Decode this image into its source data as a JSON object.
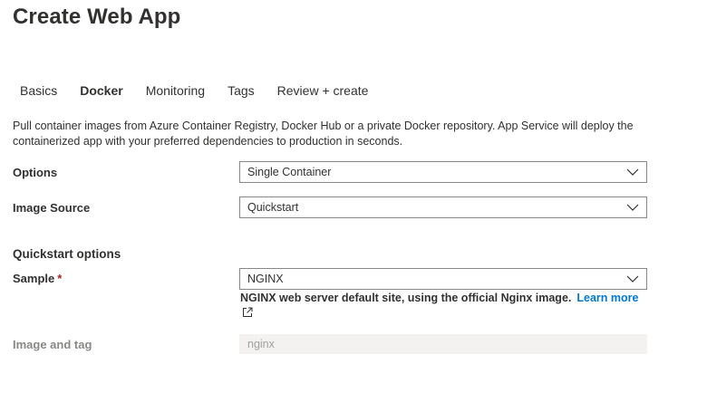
{
  "page": {
    "title": "Create Web App"
  },
  "tabs": [
    {
      "label": "Basics",
      "active": false
    },
    {
      "label": "Docker",
      "active": true
    },
    {
      "label": "Monitoring",
      "active": false
    },
    {
      "label": "Tags",
      "active": false
    },
    {
      "label": "Review + create",
      "active": false
    }
  ],
  "description": "Pull container images from Azure Container Registry, Docker Hub or a private Docker repository. App Service will deploy the containerized app with your preferred dependencies to production in seconds.",
  "form": {
    "options": {
      "label": "Options",
      "value": "Single Container"
    },
    "image_source": {
      "label": "Image Source",
      "value": "Quickstart"
    },
    "quickstart_heading": "Quickstart options",
    "sample": {
      "label": "Sample",
      "required_mark": "*",
      "value": "NGINX",
      "description": "NGINX web server default site, using the official Nginx image.",
      "learn_more": "Learn more"
    },
    "image_and_tag": {
      "label": "Image and tag",
      "placeholder": "nginx"
    }
  },
  "colors": {
    "link": "#0078d4",
    "required": "#a4262c",
    "border": "#8a8886",
    "disabled_bg": "#f3f2f1"
  },
  "icons": {
    "dropdown": "chevron-down-icon",
    "external": "external-link-icon"
  }
}
